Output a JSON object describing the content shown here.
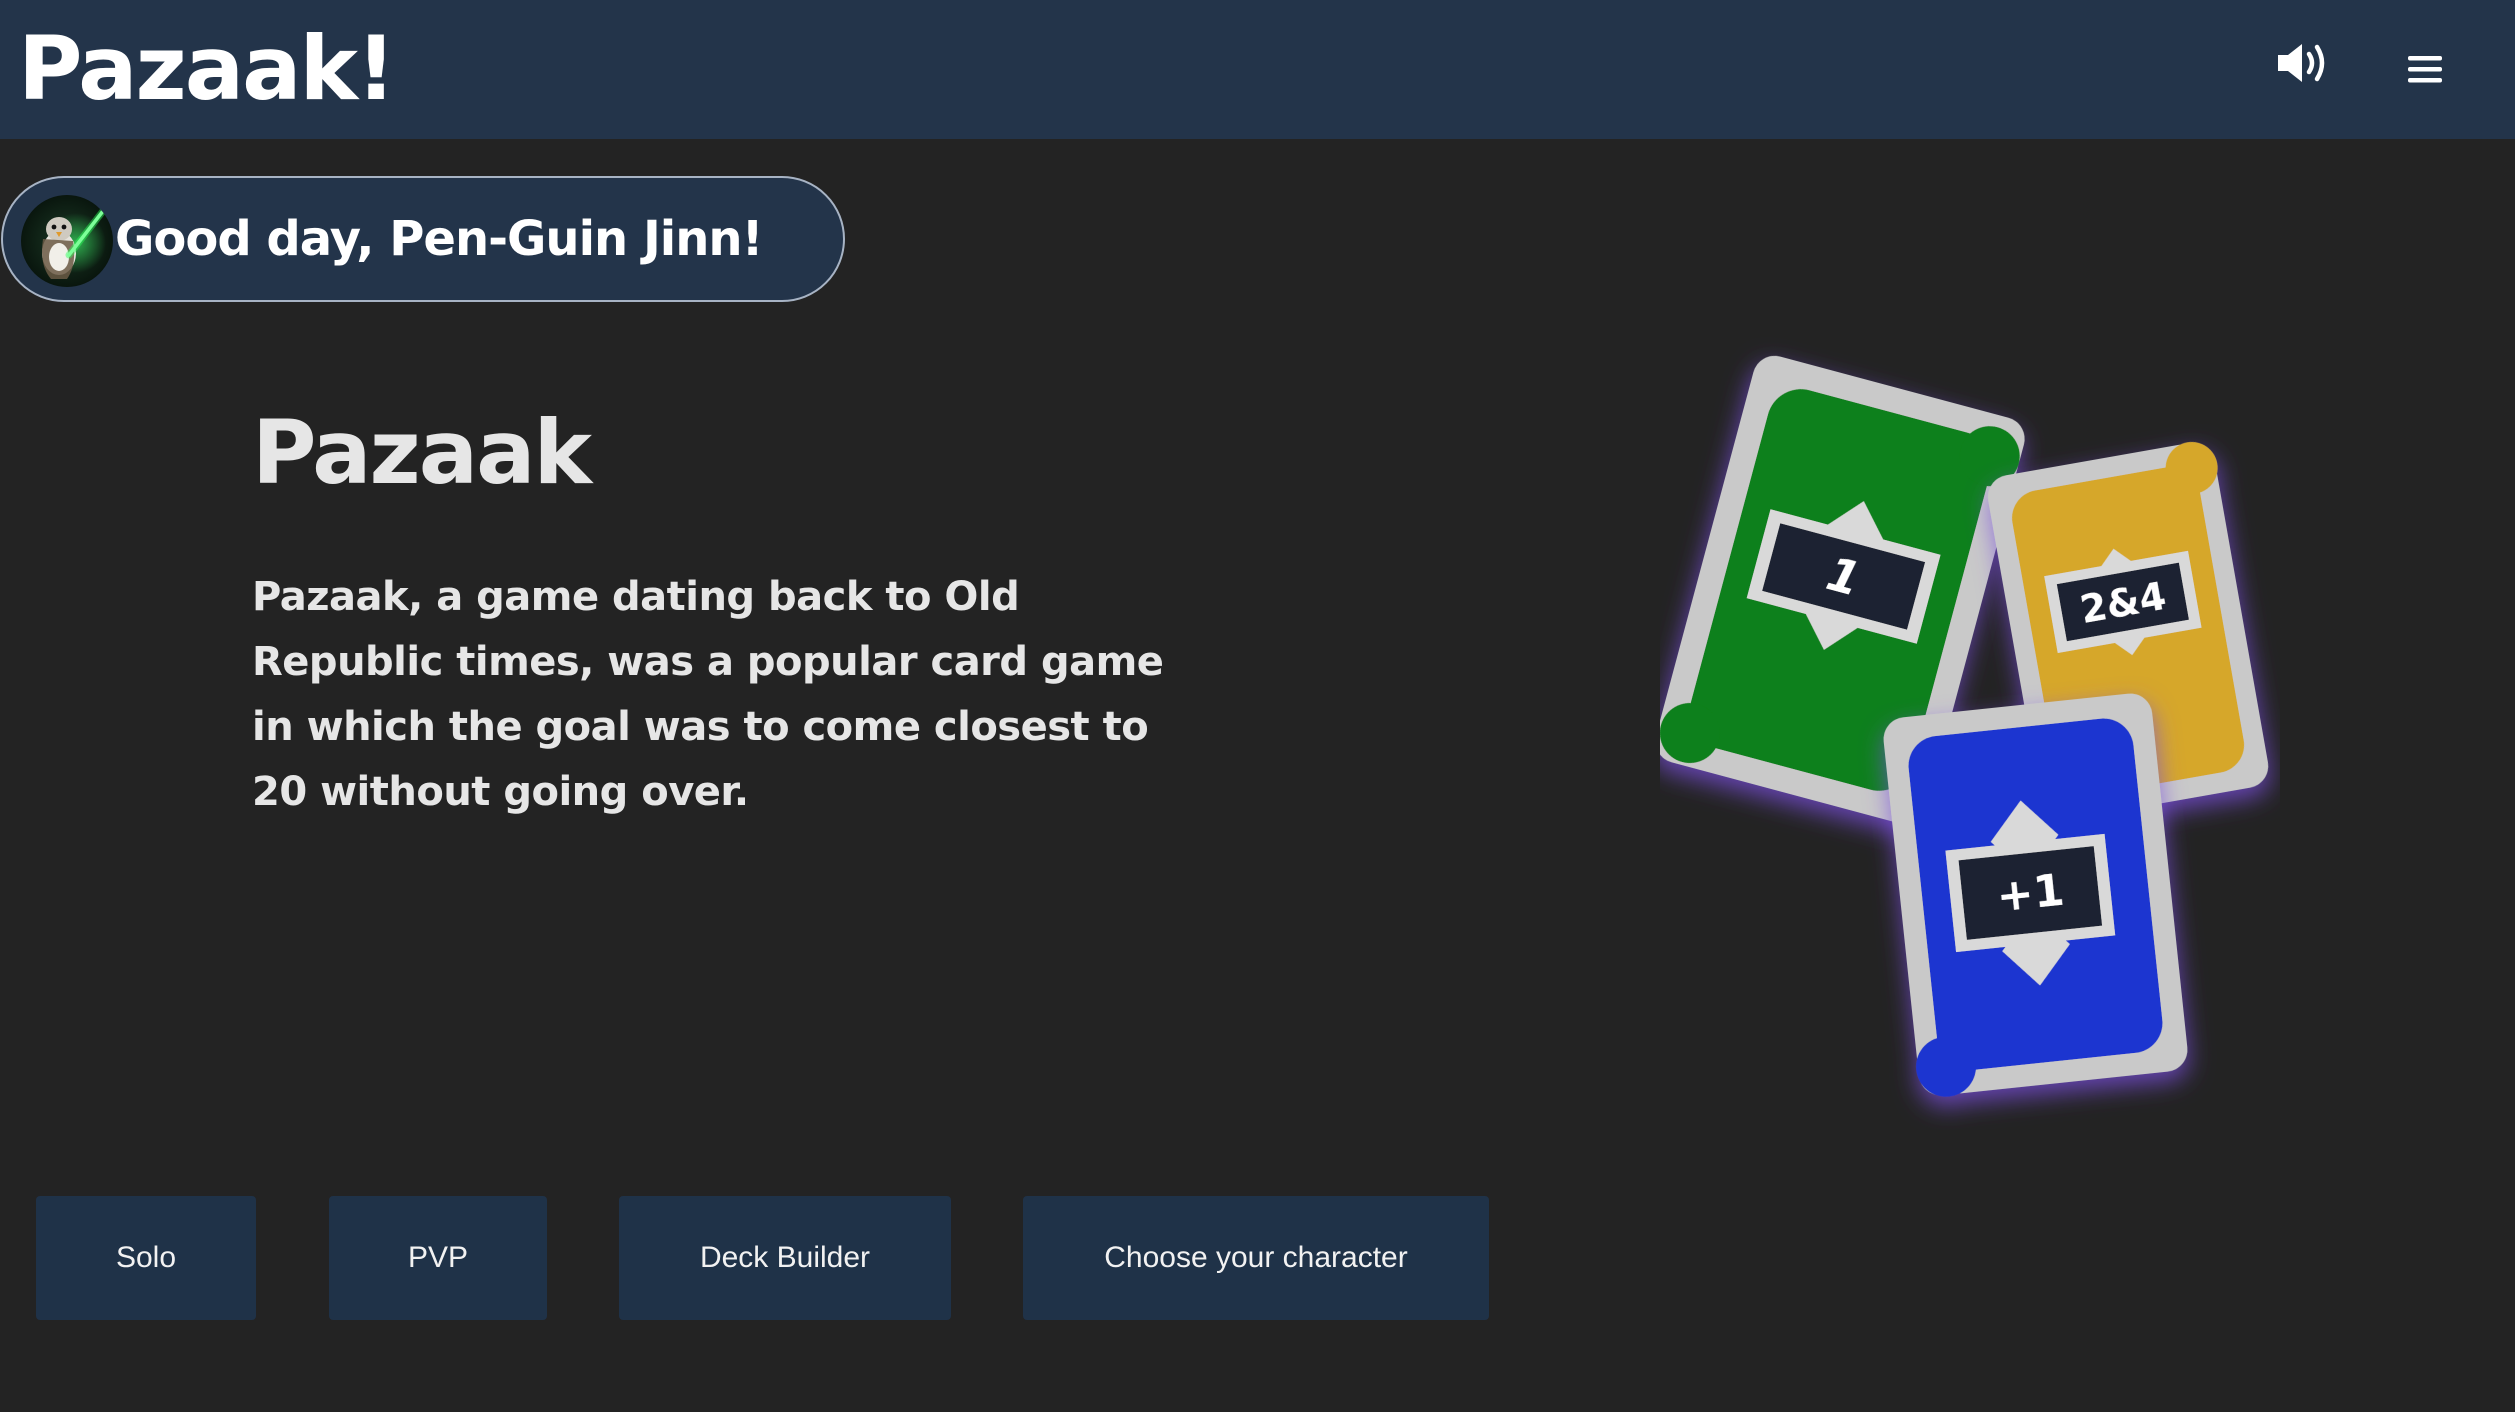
{
  "header": {
    "brand": "Pazaak!",
    "sound_icon": "speaker-on-icon",
    "menu_icon": "hamburger-menu-icon"
  },
  "greeting": {
    "text": "Good day, Pen-Guin Jinn!",
    "avatar": "penguin-jedi-avatar"
  },
  "hero": {
    "title": "Pazaak",
    "description": "Pazaak, a game dating back to Old Republic times, was a popular card game in which the goal was to come closest to 20 without going over."
  },
  "illustration": {
    "cards": [
      {
        "label": "1",
        "color": "#11801a"
      },
      {
        "label": "2&4",
        "color": "#d6a72c"
      },
      {
        "label": "+1",
        "color": "#1b36d0"
      }
    ]
  },
  "actions": [
    {
      "label": "Solo"
    },
    {
      "label": "PVP"
    },
    {
      "label": "Deck Builder"
    },
    {
      "label": "Choose your character"
    }
  ],
  "colors": {
    "background": "#232323",
    "header": "#23344a",
    "button": "#1f3248",
    "card_frame": "#c9c9c9",
    "card_glow": "#7c4fe0"
  }
}
